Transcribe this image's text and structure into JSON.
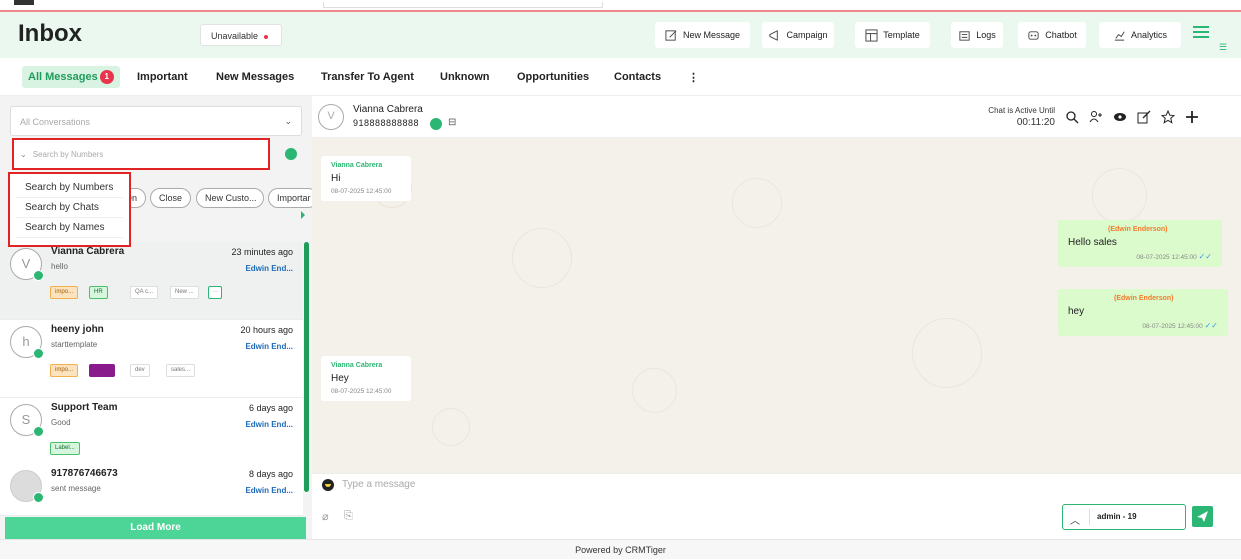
{
  "header": {
    "title": "Inbox",
    "status": "Unavailable",
    "buttons": [
      {
        "label": "New Message",
        "icon": "compose-icon"
      },
      {
        "label": "Campaign",
        "icon": "megaphone-icon"
      },
      {
        "label": "Template",
        "icon": "template-icon"
      },
      {
        "label": "Logs",
        "icon": "logs-icon"
      },
      {
        "label": "Chatbot",
        "icon": "chatbot-icon"
      },
      {
        "label": "Analytics",
        "icon": "analytics-icon"
      }
    ],
    "accent": "#2bb673"
  },
  "tabs": [
    {
      "label": "All Messages",
      "badge": "1",
      "active": true
    },
    {
      "label": "Important"
    },
    {
      "label": "New Messages"
    },
    {
      "label": "Transfer To Agent"
    },
    {
      "label": "Unknown"
    },
    {
      "label": "Opportunities"
    },
    {
      "label": "Contacts"
    },
    {
      "label": "⋮"
    }
  ],
  "filters": {
    "conversation_select": "All Conversations",
    "search_placeholder": "Search by Numbers",
    "search_options": [
      "Search by Numbers",
      "Search by Chats",
      "Search by Names"
    ],
    "chips": [
      "en",
      "Close",
      "New Custo...",
      "Importar"
    ]
  },
  "conversations": [
    {
      "initial": "V",
      "name": "Vianna Cabrera",
      "preview": "hello",
      "time": "23 minutes ago",
      "agent": "Edwin End...",
      "labels": [
        {
          "text": "impo...",
          "style": "orange"
        },
        {
          "text": "HR",
          "style": "green"
        },
        {
          "text": "QA c...",
          "style": "plain"
        },
        {
          "text": "New ...",
          "style": "plain"
        },
        {
          "text": "···",
          "style": "more"
        }
      ]
    },
    {
      "initial": "h",
      "name": "heeny john",
      "preview": "starttemplate",
      "time": "20 hours ago",
      "agent": "Edwin End...",
      "labels": [
        {
          "text": "impo...",
          "style": "orange"
        },
        {
          "text": "wha...",
          "style": "purple"
        },
        {
          "text": "dev",
          "style": "plain"
        },
        {
          "text": "sales...",
          "style": "plain"
        }
      ]
    },
    {
      "initial": "S",
      "name": "Support Team",
      "preview": "Good",
      "time": "6 days ago",
      "agent": "Edwin End...",
      "labels": [
        {
          "text": "Label...",
          "style": "green"
        }
      ]
    },
    {
      "initial": "",
      "name": "917876746673",
      "preview": "sent message",
      "time": "8 days ago",
      "agent": "Edwin End...",
      "labels": []
    }
  ],
  "load_more": "Load More",
  "chat": {
    "contact_initial": "V",
    "contact_name": "Vianna Cabrera",
    "contact_phone": "918888888888",
    "active_label": "Chat is Active Until",
    "active_timer": "00:11:20",
    "messages": [
      {
        "dir": "in",
        "from": "Vianna Cabrera",
        "text": "Hi",
        "time": "08-07-2025 12:45:00"
      },
      {
        "dir": "out",
        "from": "(Edwin Enderson)",
        "text": "Hello sales",
        "time": "08-07-2025 12:45:00"
      },
      {
        "dir": "out",
        "from": "(Edwin Enderson)",
        "text": "hey",
        "time": "08-07-2025 12:45:00"
      },
      {
        "dir": "in",
        "from": "Vianna Cabrera",
        "text": "Hey",
        "time": "08-07-2025 12:45:00"
      }
    ],
    "compose_placeholder": "Type a message",
    "sender_label": "admin - 19",
    "tick": "✓✓"
  },
  "footer": "Powered by CRMTiger"
}
